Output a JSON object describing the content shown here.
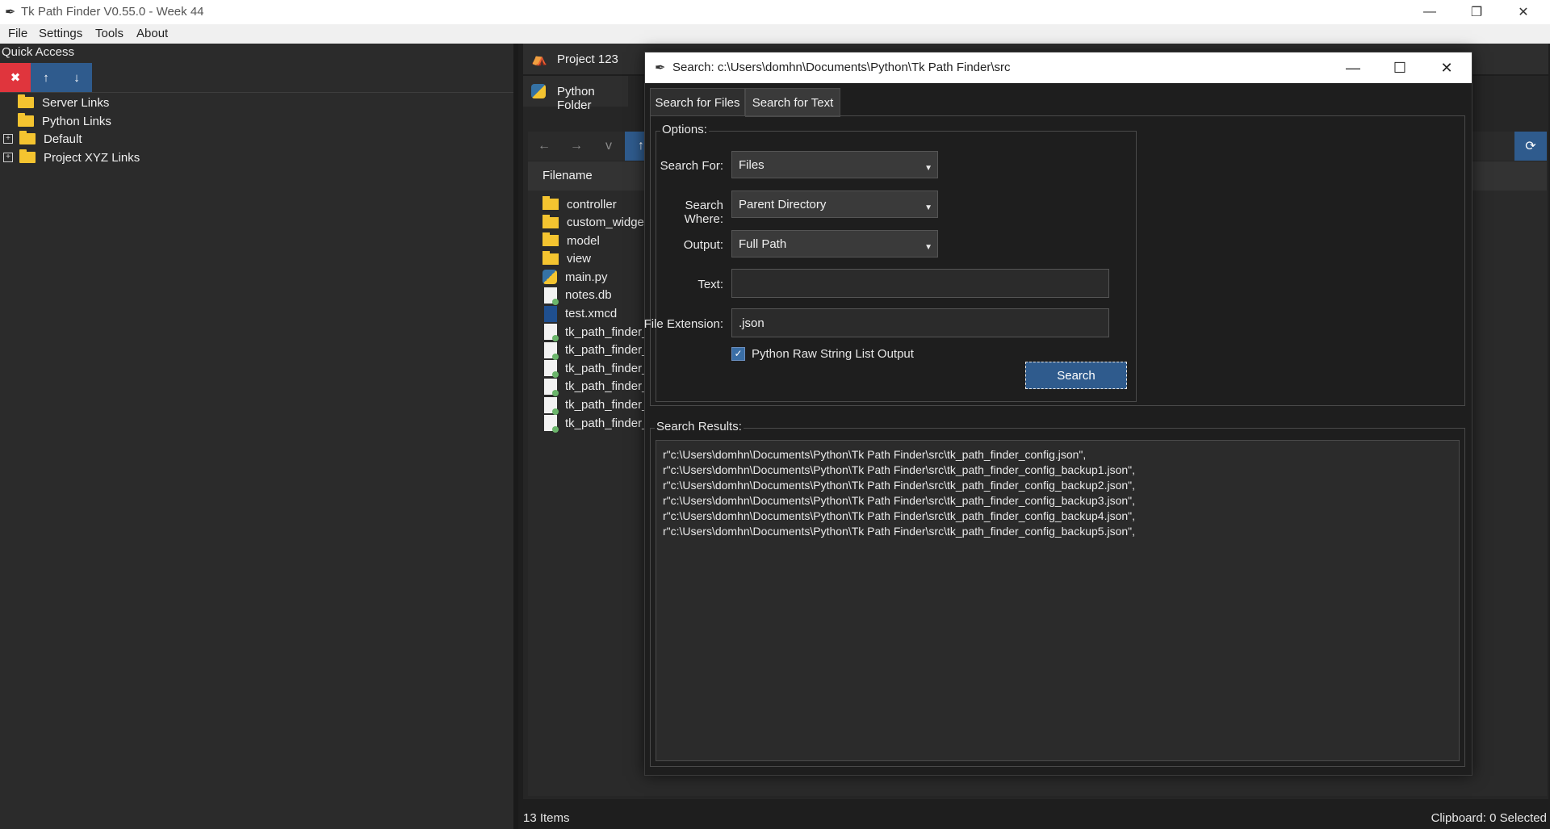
{
  "app": {
    "title": "Tk Path Finder V0.55.0 - Week 44",
    "window_controls": {
      "minimize": "—",
      "restore": "❐",
      "close": "✕"
    }
  },
  "menu": [
    "File",
    "Settings",
    "Tools",
    "About"
  ],
  "quick_access": {
    "title": "Quick Access",
    "buttons": {
      "remove": "✖",
      "up": "↑",
      "down": "↓"
    },
    "tree": [
      {
        "label": "Server Links",
        "expandable": false
      },
      {
        "label": "Python Links",
        "expandable": false
      },
      {
        "label": "Default",
        "expandable": true
      },
      {
        "label": "Project XYZ Links",
        "expandable": true
      }
    ]
  },
  "right": {
    "tabs": [
      "Project 123",
      "Python Folder"
    ],
    "nav": {
      "back": "←",
      "forward": "→",
      "dropdown": "v",
      "up": "↑",
      "refresh": "⟳"
    },
    "filename_header": "Filename",
    "files": [
      {
        "name": "controller",
        "type": "folder"
      },
      {
        "name": "custom_widget",
        "type": "folder"
      },
      {
        "name": "model",
        "type": "folder"
      },
      {
        "name": "view",
        "type": "folder"
      },
      {
        "name": "main.py",
        "type": "python"
      },
      {
        "name": "notes.db",
        "type": "file"
      },
      {
        "name": "test.xmcd",
        "type": "mathcad"
      },
      {
        "name": "tk_path_finder_",
        "type": "file"
      },
      {
        "name": "tk_path_finder_",
        "type": "file"
      },
      {
        "name": "tk_path_finder_",
        "type": "file"
      },
      {
        "name": "tk_path_finder_",
        "type": "file"
      },
      {
        "name": "tk_path_finder_",
        "type": "file"
      },
      {
        "name": "tk_path_finder_",
        "type": "file"
      }
    ],
    "status_items": "13 Items",
    "status_clipboard": "Clipboard: 0 Selected"
  },
  "dialog": {
    "title": "Search: c:\\Users\\domhn\\Documents\\Python\\Tk Path Finder\\src",
    "tabs": [
      "Search for Files",
      "Search for Text"
    ],
    "options_label": "Options:",
    "search_for": {
      "label": "Search For:",
      "value": "Files"
    },
    "search_where": {
      "label": "Search Where:",
      "value": "Parent Directory"
    },
    "output": {
      "label": "Output:",
      "value": "Full Path"
    },
    "text": {
      "label": "Text:",
      "value": ""
    },
    "file_extension": {
      "label": "File Extension:",
      "value": ".json"
    },
    "raw_string_checkbox": {
      "label": "Python Raw String List Output",
      "checked": true,
      "mark": "✓"
    },
    "search_button": "Search",
    "results_label": "Search Results:",
    "results": [
      "r\"c:\\Users\\domhn\\Documents\\Python\\Tk Path Finder\\src\\tk_path_finder_config.json\",",
      "r\"c:\\Users\\domhn\\Documents\\Python\\Tk Path Finder\\src\\tk_path_finder_config_backup1.json\",",
      "r\"c:\\Users\\domhn\\Documents\\Python\\Tk Path Finder\\src\\tk_path_finder_config_backup2.json\",",
      "r\"c:\\Users\\domhn\\Documents\\Python\\Tk Path Finder\\src\\tk_path_finder_config_backup3.json\",",
      "r\"c:\\Users\\domhn\\Documents\\Python\\Tk Path Finder\\src\\tk_path_finder_config_backup4.json\",",
      "r\"c:\\Users\\domhn\\Documents\\Python\\Tk Path Finder\\src\\tk_path_finder_config_backup5.json\","
    ]
  },
  "colors": {
    "accent": "#2f5b8d",
    "danger": "#e0353d",
    "folder": "#f4c430"
  }
}
